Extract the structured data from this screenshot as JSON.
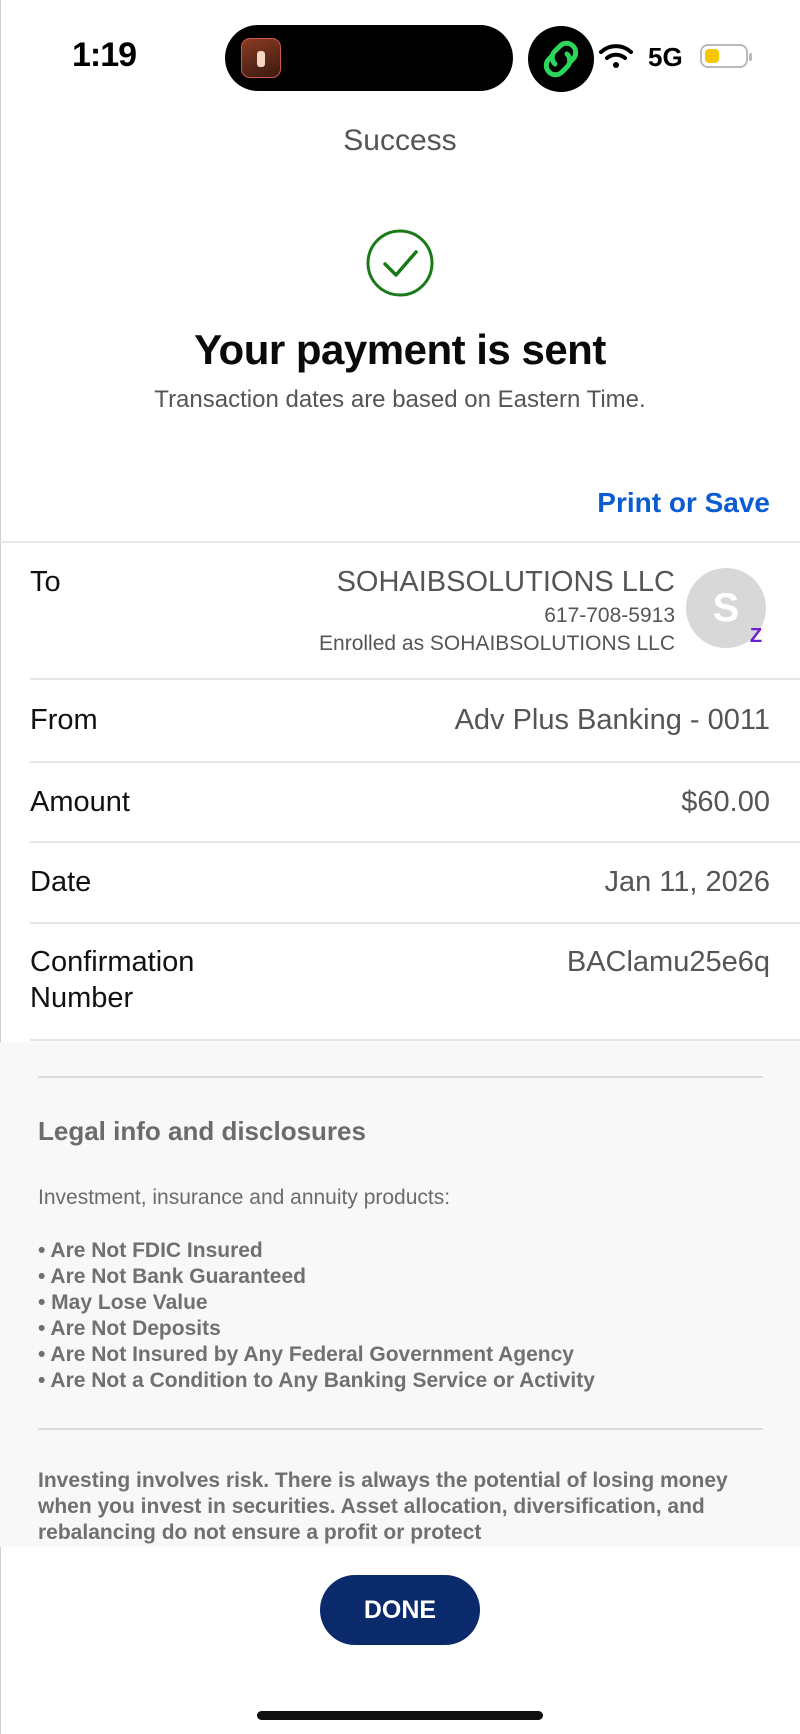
{
  "status_bar": {
    "time": "1:19",
    "network": "5G"
  },
  "header": {
    "title": "Success"
  },
  "result": {
    "headline": "Your payment is sent",
    "subtext": "Transaction dates are based on Eastern Time.",
    "print_label": "Print or Save",
    "success_color": "#1a7a1a"
  },
  "details": {
    "to": {
      "label": "To",
      "name": "SOHAIBSOLUTIONS LLC",
      "phone": "617-708-5913",
      "enrolled": "Enrolled as SOHAIBSOLUTIONS LLC",
      "avatar_initial": "S"
    },
    "from": {
      "label": "From",
      "value": "Adv Plus Banking - 0011"
    },
    "amount": {
      "label": "Amount",
      "value": "$60.00"
    },
    "date": {
      "label": "Date",
      "value": "Jan 11, 2026"
    },
    "confirmation": {
      "label_line1": "Confirmation",
      "label_line2": "Number",
      "value": "BAClamu25e6q"
    }
  },
  "legal": {
    "title": "Legal info and disclosures",
    "intro": "Investment, insurance and annuity products:",
    "items": [
      "• Are Not FDIC Insured",
      "• Are Not Bank Guaranteed",
      "• May Lose Value",
      "• Are Not Deposits",
      "• Are Not Insured by Any Federal Government Agency",
      "• Are Not a Condition to Any Banking Service or Activity"
    ],
    "risk_text": "Investing involves risk. There is always the potential of losing money when you invest in securities. Asset allocation, diversification, and rebalancing do not ensure a profit or protect"
  },
  "footer": {
    "done_label": "DONE",
    "button_color": "#0a2a6b"
  }
}
